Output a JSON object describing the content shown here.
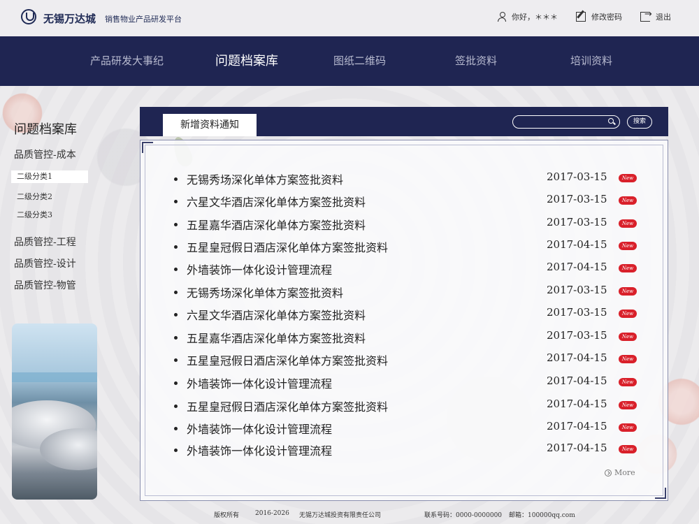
{
  "header": {
    "brand": "无锡万达城",
    "subtitle": "销售物业产品研发平台",
    "greeting": "你好，＊＊＊",
    "change_password": "修改密码",
    "logout": "退出"
  },
  "nav": [
    {
      "label": "产品研发大事纪",
      "active": false
    },
    {
      "label": "问题档案库",
      "active": true
    },
    {
      "label": "图纸二维码",
      "active": false
    },
    {
      "label": "签批资料",
      "active": false
    },
    {
      "label": "培训资料",
      "active": false
    }
  ],
  "sidebar": {
    "title": "问题档案库",
    "items": [
      {
        "label": "品质管控-成本"
      },
      {
        "label": "二级分类1",
        "sub": true,
        "active": true
      },
      {
        "label": "二级分类2",
        "sub": true
      },
      {
        "label": "二级分类3",
        "sub": true
      },
      {
        "label": "品质管控-工程"
      },
      {
        "label": "品质管控-设计"
      },
      {
        "label": "品质管控-物管"
      }
    ]
  },
  "panel": {
    "tab": "新增资料通知",
    "search_placeholder": "",
    "search_button": "搜索",
    "more": "More",
    "new_badge": "New",
    "rows": [
      {
        "title": "无锡秀场深化单体方案签批资料",
        "date": "2017-03-15"
      },
      {
        "title": "六星文华酒店深化单体方案签批资料",
        "date": "2017-03-15"
      },
      {
        "title": "五星嘉华酒店深化单体方案签批资料",
        "date": "2017-03-15"
      },
      {
        "title": "五星皇冠假日酒店深化单体方案签批资料",
        "date": "2017-04-15"
      },
      {
        "title": "外墙装饰一体化设计管理流程",
        "date": "2017-04-15"
      },
      {
        "title": "无锡秀场深化单体方案签批资料",
        "date": "2017-03-15"
      },
      {
        "title": "六星文华酒店深化单体方案签批资料",
        "date": "2017-03-15"
      },
      {
        "title": "五星嘉华酒店深化单体方案签批资料",
        "date": "2017-03-15"
      },
      {
        "title": "五星皇冠假日酒店深化单体方案签批资料",
        "date": "2017-04-15"
      },
      {
        "title": "外墙装饰一体化设计管理流程",
        "date": "2017-04-15"
      },
      {
        "title": "五星皇冠假日酒店深化单体方案签批资料",
        "date": "2017-04-15"
      },
      {
        "title": "外墙装饰一体化设计管理流程",
        "date": "2017-04-15"
      },
      {
        "title": "外墙装饰一体化设计管理流程",
        "date": "2017-04-15"
      }
    ]
  },
  "footer": {
    "copyright": "版权所有",
    "years": "2016-2026",
    "company": "无锡万达城投资有限责任公司",
    "phone": "联系号码：0000-0000000",
    "email": "邮箱：100000qq.com"
  }
}
